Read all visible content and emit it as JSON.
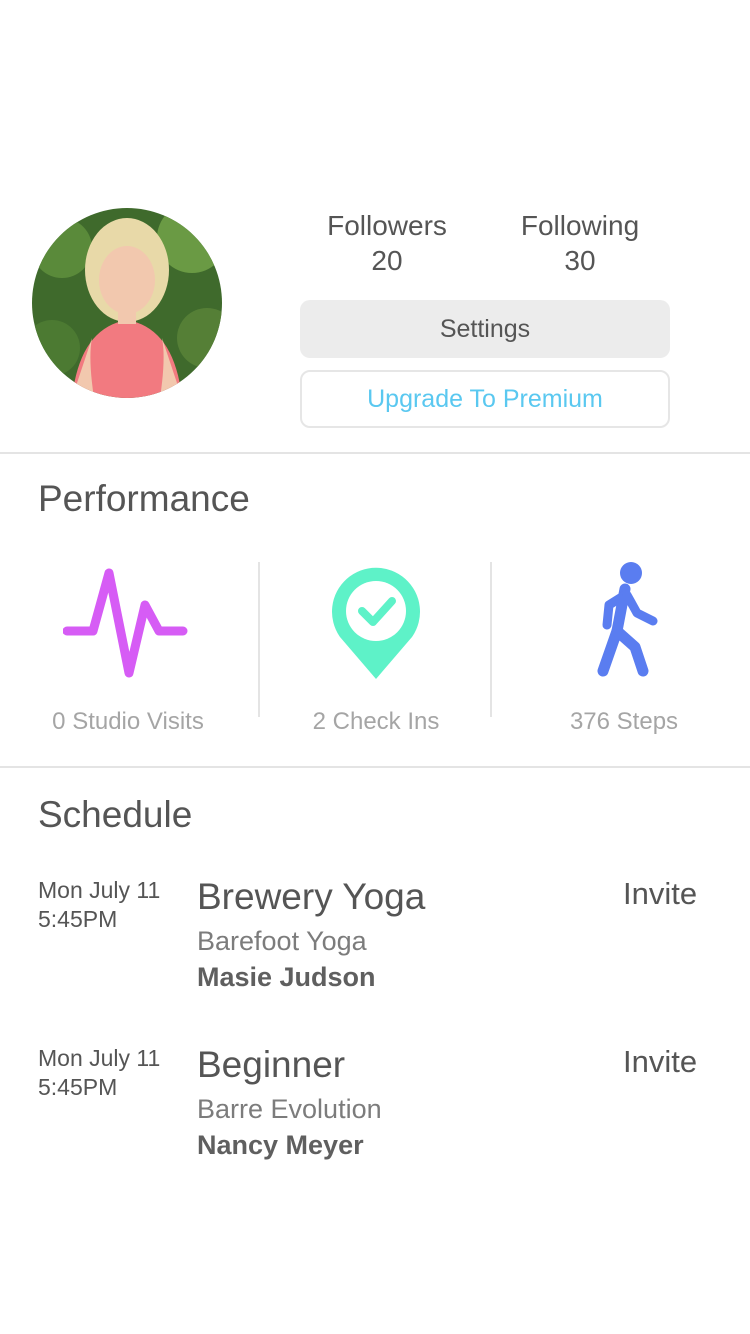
{
  "profile": {
    "followers_label": "Followers",
    "followers_count": "20",
    "following_label": "Following",
    "following_count": "30",
    "settings_label": "Settings",
    "premium_label": "Upgrade To Premium"
  },
  "performance": {
    "title": "Performance",
    "metrics": [
      {
        "icon": "heartbeat-icon",
        "label": "0 Studio Visits",
        "color": "#d65cf5"
      },
      {
        "icon": "location-check-icon",
        "label": "2 Check Ins",
        "color": "#5ef2c8"
      },
      {
        "icon": "walking-person-icon",
        "label": "376 Steps",
        "color": "#5a7df0"
      }
    ]
  },
  "schedule": {
    "title": "Schedule",
    "events": [
      {
        "date": "Mon July 11",
        "time": "5:45PM",
        "class_name": "Brewery Yoga",
        "studio": "Barefoot Yoga",
        "instructor": "Masie Judson",
        "action": "Invite"
      },
      {
        "date": "Mon July 11",
        "time": "5:45PM",
        "class_name": "Beginner",
        "studio": "Barre Evolution",
        "instructor": "Nancy Meyer",
        "action": "Invite"
      }
    ]
  },
  "colors": {
    "accent_blue": "#5ac8f0",
    "divider": "#e4e4e4"
  }
}
